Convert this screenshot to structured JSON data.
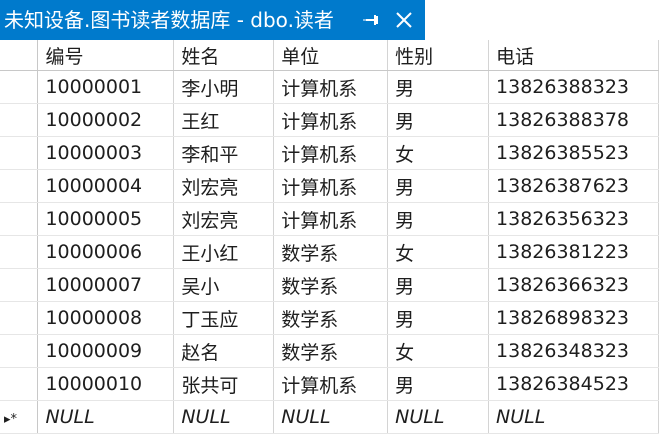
{
  "tab": {
    "title": "未知设备.图书读者数据库 - dbo.读者",
    "pin_icon": "pin-icon",
    "close_icon": "close-icon",
    "accent_color": "#007acc"
  },
  "grid": {
    "columns": [
      "编号",
      "姓名",
      "单位",
      "性别",
      "电话"
    ],
    "rows": [
      [
        "10000001",
        "李小明",
        "计算机系",
        "男",
        "13826388323"
      ],
      [
        "10000002",
        "王红",
        "计算机系",
        "男",
        "13826388378"
      ],
      [
        "10000003",
        "李和平",
        "计算机系",
        "女",
        "13826385523"
      ],
      [
        "10000004",
        "刘宏亮",
        "计算机系",
        "男",
        "13826387623"
      ],
      [
        "10000005",
        "刘宏亮",
        "计算机系",
        "男",
        "13826356323"
      ],
      [
        "10000006",
        "王小红",
        "数学系",
        "女",
        "13826381223"
      ],
      [
        "10000007",
        "吴小",
        "数学系",
        "男",
        "13826366323"
      ],
      [
        "10000008",
        "丁玉应",
        "数学系",
        "男",
        "13826898323"
      ],
      [
        "10000009",
        "赵名",
        "数学系",
        "女",
        "13826348323"
      ],
      [
        "10000010",
        "张共可",
        "计算机系",
        "男",
        "13826384523"
      ]
    ],
    "new_row": [
      "NULL",
      "NULL",
      "NULL",
      "NULL",
      "NULL"
    ],
    "new_row_marker": "▸*"
  }
}
